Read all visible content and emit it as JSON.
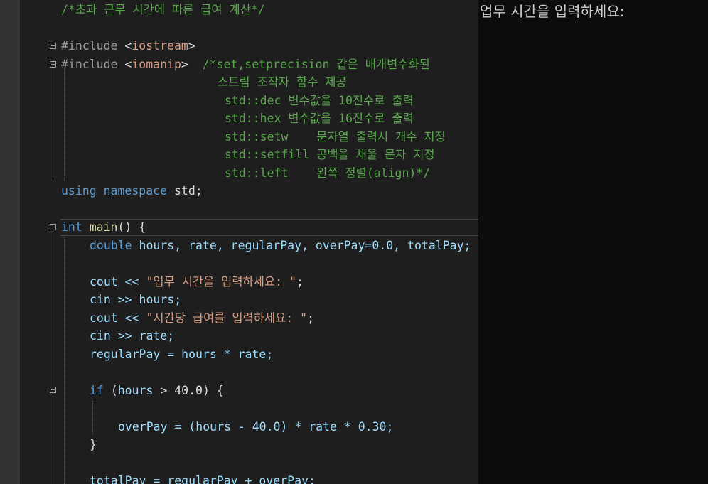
{
  "editor": {
    "lines": [
      "/*초과 근무 시간에 따른 급여 계산*/",
      "#include <iostream>",
      "#include <iomanip>",
      "/*set,setprecision 같은 매개변수화된",
      "스트림 조작자 함수 제공",
      "std::dec 변수값을 10진수로 출력",
      "std::hex 변수값을 16진수로 출력",
      "std::setw    문자열 출력시 개수 지정",
      "std::setfill 공백을 채울 문자 지정",
      "std::left    왼쪽 정렬(align)*/",
      "using namespace std;",
      "int main() {",
      "double hours, rate, regularPay, overPay=0.0, totalPay;",
      "cout << \"업무 시간을 입력하세요: \";",
      "cin >> hours;",
      "cout << \"시간당 급여를 입력하세요: \";",
      "cin >> rate;",
      "regularPay = hours * rate;",
      "if (hours > 40.0) {",
      "overPay = (hours - 40.0) * rate * 0.30;",
      "}",
      "totalPay = regularPay + overPay;"
    ]
  },
  "console": {
    "output": "업무 시간을 입력하세요:"
  },
  "colors": {
    "comment": "#57a64a",
    "keyword": "#569cd6",
    "string": "#d69d85",
    "variable": "#9cdcfe",
    "console_bg": "#0c0c0c",
    "editor_bg": "#1e1e1e"
  }
}
